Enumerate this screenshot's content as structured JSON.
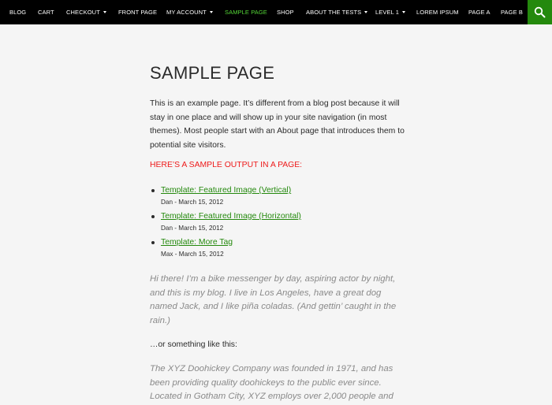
{
  "nav": {
    "items": [
      {
        "label": "Blog",
        "dropdown": false,
        "active": false
      },
      {
        "label": "Cart",
        "dropdown": false,
        "active": false
      },
      {
        "label": "Checkout",
        "dropdown": true,
        "active": false
      },
      {
        "label": "Front Page",
        "dropdown": false,
        "active": false
      },
      {
        "label": "My Account",
        "dropdown": true,
        "active": false
      },
      {
        "label": "Sample Page",
        "dropdown": false,
        "active": true
      },
      {
        "label": "Shop",
        "dropdown": false,
        "active": false
      },
      {
        "label": "About The Tests",
        "dropdown": true,
        "active": false
      },
      {
        "label": "Level 1",
        "dropdown": true,
        "active": false
      },
      {
        "label": "Lorem Ipsum",
        "dropdown": false,
        "active": false
      },
      {
        "label": "Page A",
        "dropdown": false,
        "active": false
      },
      {
        "label": "Page B",
        "dropdown": false,
        "active": false
      }
    ],
    "search_icon": "search-icon",
    "colors": {
      "bar": "#000000",
      "active": "#55d737",
      "search_bg": "#24890d"
    }
  },
  "page": {
    "title": "Sample Page",
    "intro": "This is an example page. It’s different from a blog post because it will stay in one place and will show up in your site navigation (in most themes). Most people start with an About page that introduces them to potential site visitors.",
    "subheading": "Here’s a sample output in a page:",
    "posts": [
      {
        "title": "Template: Featured Image (Vertical)",
        "meta": "Dan - March 15, 2012"
      },
      {
        "title": "Template: Featured Image (Horizontal)",
        "meta": "Dan - March 15, 2012"
      },
      {
        "title": "Template: More Tag",
        "meta": "Max - March 15, 2012"
      }
    ],
    "quote1": "Hi there! I’m a bike messenger by day, aspiring actor by night, and this is my blog. I live in Los Angeles, have a great dog named Jack, and I like piña coladas. (And gettin’ caught in the rain.)",
    "between": "…or something like this:",
    "quote2": "The XYZ Doohickey Company was founded in 1971, and has been providing quality doohickeys to the public ever since. Located in Gotham City, XYZ employs over 2,000 people and",
    "colors": {
      "link": "#24890d",
      "subheading": "#ee1a1a",
      "quote": "#8a8a8a"
    }
  }
}
